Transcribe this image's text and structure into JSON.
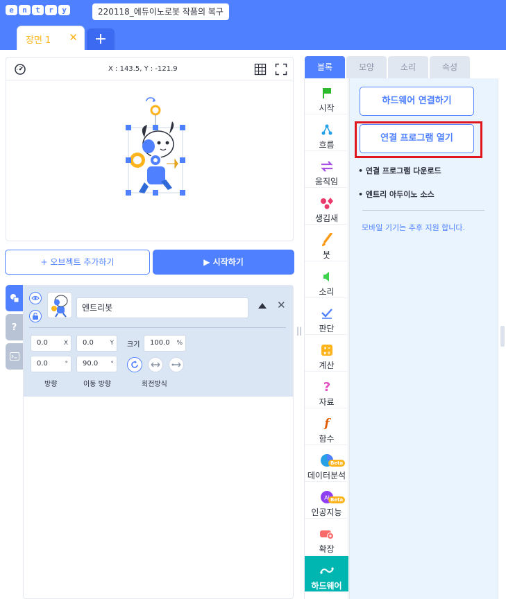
{
  "app": {
    "logo_letters": [
      "e",
      "n",
      "t",
      "r",
      "y"
    ],
    "project_title": "220118_에듀이노로봇 작품의 복구"
  },
  "scene": {
    "tab_label": "장면 1",
    "close_glyph": "✕",
    "add_glyph": "+"
  },
  "stage": {
    "coords": "X : 143.5, Y : -121.9"
  },
  "actions": {
    "add_object": "+ 오브젝트 추가하기",
    "start": "▶ 시작하기"
  },
  "object": {
    "name": "엔트리봇",
    "x_value": "0.0",
    "x_unit": "X",
    "y_value": "0.0",
    "y_unit": "Y",
    "size_label": "크기",
    "size_value": "100.0",
    "size_unit": "%",
    "direction_value": "0.0",
    "direction_unit": "°",
    "move_direction_value": "90.0",
    "move_direction_unit": "°",
    "direction_label": "방향",
    "move_direction_label": "이동 방향",
    "rotation_label": "회전방식",
    "delete_glyph": "✕"
  },
  "right_tabs": [
    "블록",
    "모양",
    "소리",
    "속성"
  ],
  "categories": [
    {
      "label": "시작",
      "icon": "flag-icon"
    },
    {
      "label": "흐름",
      "icon": "flow-icon"
    },
    {
      "label": "움직임",
      "icon": "move-arrows-icon"
    },
    {
      "label": "생김새",
      "icon": "looks-icon"
    },
    {
      "label": "붓",
      "icon": "brush-icon"
    },
    {
      "label": "소리",
      "icon": "speaker-icon"
    },
    {
      "label": "판단",
      "icon": "check-icon"
    },
    {
      "label": "계산",
      "icon": "calculator-icon"
    },
    {
      "label": "자료",
      "icon": "question-icon"
    },
    {
      "label": "함수",
      "icon": "function-icon"
    },
    {
      "label": "데이터분석",
      "icon": "pie-chart-icon",
      "badge": "Beta"
    },
    {
      "label": "인공지능",
      "icon": "ai-icon",
      "badge": "Beta"
    },
    {
      "label": "확장",
      "icon": "extension-icon"
    },
    {
      "label": "하드웨어",
      "icon": "hardware-icon"
    }
  ],
  "hardware": {
    "connect_button": "하드웨어 연결하기",
    "open_program_button": "연결 프로그램 열기",
    "download_link": "• 연결 프로그램 다운로드",
    "arduino_link": "• 엔트리 아두이노 소스",
    "mobile_note": "모바일 기기는 추후 지원 합니다."
  },
  "colors": {
    "brand": "#4f80ff",
    "scene_accent": "#fdb41c",
    "hardware_active": "#00b6b1",
    "highlight": "#e0161e"
  }
}
